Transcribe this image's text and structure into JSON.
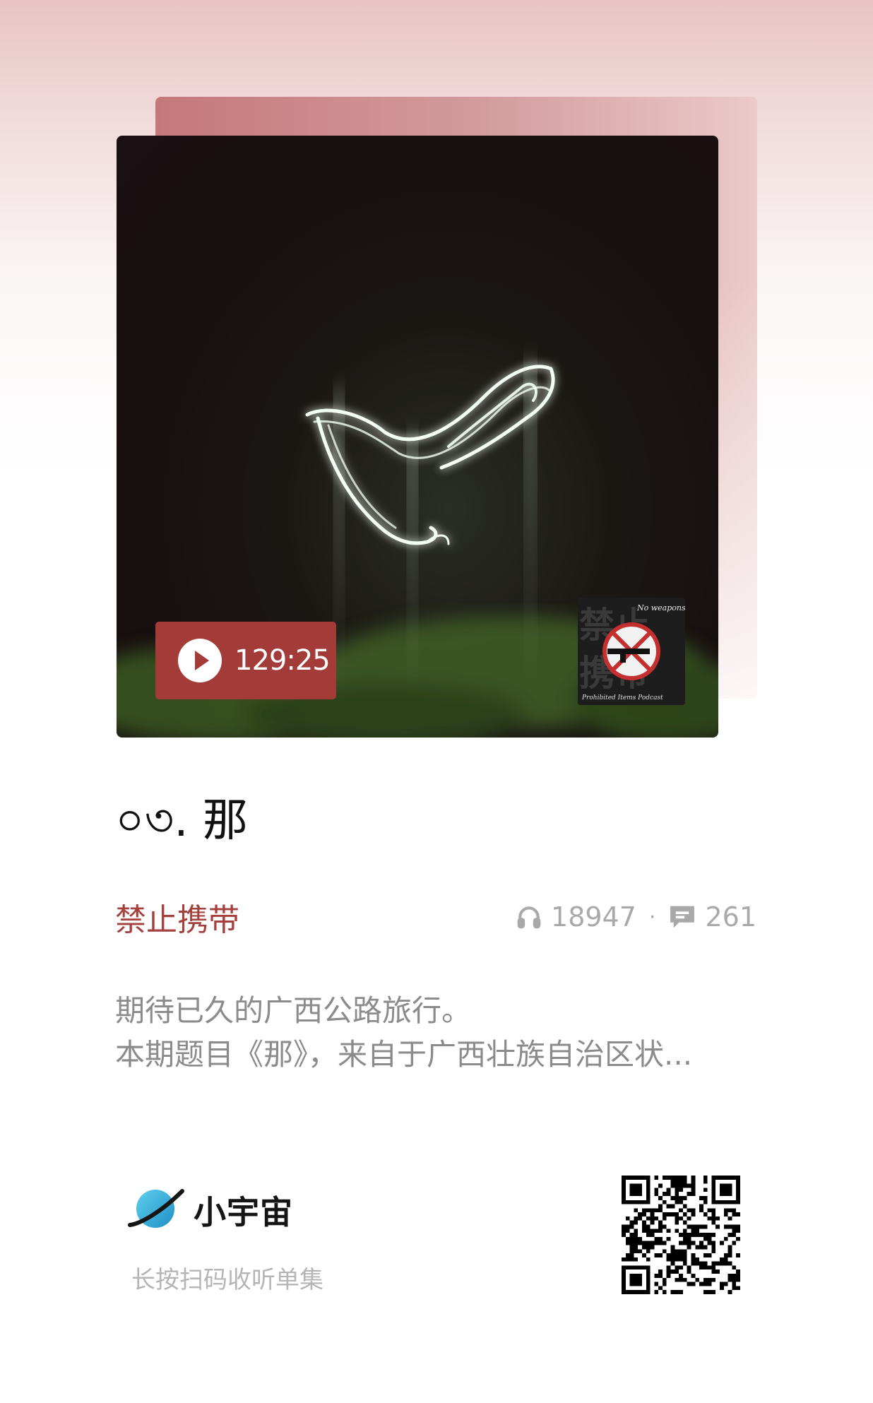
{
  "cover": {
    "duration": "129:25",
    "thumb_title": "禁止携带",
    "thumb_subtitle": "No weapons",
    "thumb_footer": "Prohibited Items Podcast"
  },
  "episode": {
    "title": "০৩. 那",
    "podcast_name": "禁止携带",
    "listen_count": "18947",
    "separator": "·",
    "comment_count": "261",
    "description_lines": [
      "期待已久的广西公路旅行。",
      "本期题目《那》，来自于广西壮族自治区状..."
    ]
  },
  "footer": {
    "brand_name": "小宇宙",
    "scan_hint": "长按扫码收听单集"
  },
  "colors": {
    "accent": "#a5403c",
    "badge": "#a33b38",
    "muted": "#a9a9a9"
  },
  "icons": {
    "listens": "headphones-icon",
    "comments": "comment-icon",
    "play": "play-icon",
    "logo": "planet-logo-icon"
  }
}
